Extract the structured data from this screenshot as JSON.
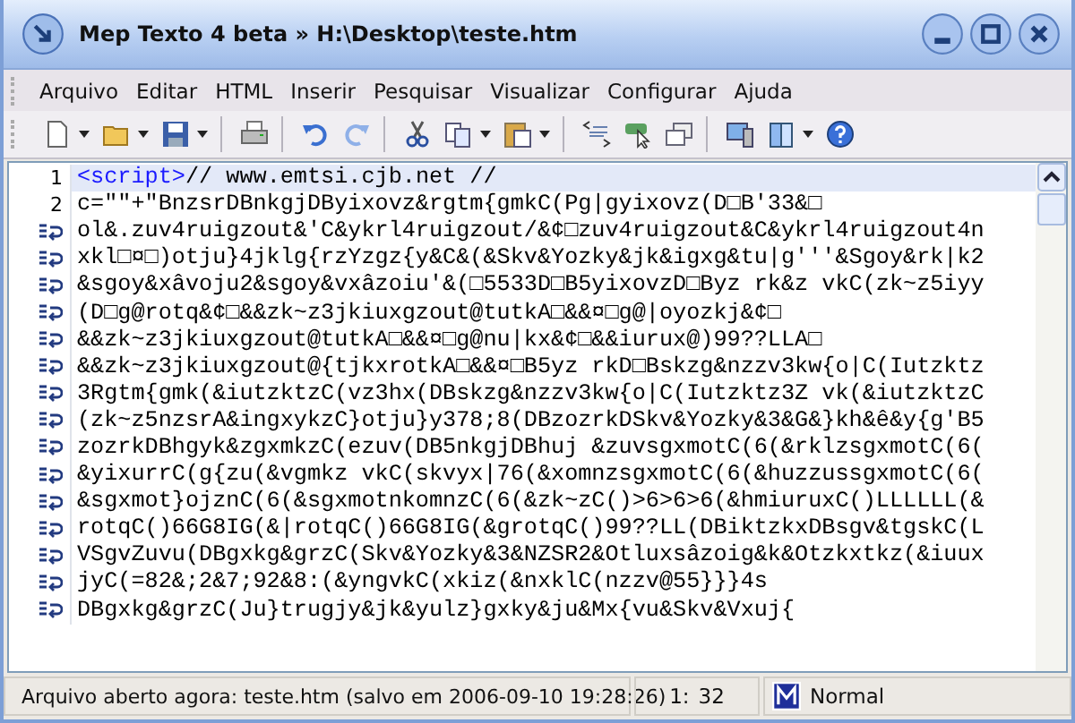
{
  "window": {
    "title": "Mep Texto 4 beta » H:\\Desktop\\teste.htm"
  },
  "menu": [
    "Arquivo",
    "Editar",
    "HTML",
    "Inserir",
    "Pesquisar",
    "Visualizar",
    "Configurar",
    "Ajuda"
  ],
  "editor": {
    "lines": [
      {
        "kind": "numbered",
        "number": "1",
        "selected": true,
        "tag": "<script>",
        "text": "// www.emtsi.cjb.net //"
      },
      {
        "kind": "numbered",
        "number": "2",
        "selected": false,
        "text": "c=\"\"+\"BnzsrDBnkgjDByixovz&rgtm{gmkC(Pg|gyixovz(D□B'33&□"
      },
      {
        "kind": "wrap",
        "selected": false,
        "text": "ol&.zuv4ruigzout&'C&ykrl4ruigzout/&¢□zuv4ruigzout&C&ykrl4ruigzout4n"
      },
      {
        "kind": "wrap",
        "selected": false,
        "text": "xkl□¤□)otju}4jklg{rzYzgz{y&C&(&Skv&Yozky&jk&igxg&tu|g'''&Sgoy&rk|k2"
      },
      {
        "kind": "wrap",
        "selected": false,
        "text": "&sgoy&xâvoju2&sgoy&vxâzoiu'&(□5533D□B5yixovzD□Byz rk&z vkC(zk~z5iyy"
      },
      {
        "kind": "wrap",
        "selected": false,
        "text": "(D□g@rotq&¢□&&zk~z3jkiuxgzout@tutkA□&&¤□g@|oyozkj&¢□"
      },
      {
        "kind": "wrap",
        "selected": false,
        "text": "&&zk~z3jkiuxgzout@tutkA□&&¤□g@nu|kx&¢□&&iurux@)99??LLA□"
      },
      {
        "kind": "wrap",
        "selected": false,
        "text": "&&zk~z3jkiuxgzout@{tjkxrotkA□&&¤□B5yz rkD□Bskzg&nzzv3kw{o|C(Iutzktz"
      },
      {
        "kind": "wrap",
        "selected": false,
        "text": "3Rgtm{gmk(&iutzktzC(vz3hx(DBskzg&nzzv3kw{o|C(Iutzktz3Z vk(&iutzktzC"
      },
      {
        "kind": "wrap",
        "selected": false,
        "text": "(zk~z5nzsrA&ingxykzC}otju}y378;8(DBzozrkDSkv&Yozky&3&G&}kh&ê&y{g'B5"
      },
      {
        "kind": "wrap",
        "selected": false,
        "text": "zozrkDBhgyk&zgxmkzC(ezuv(DB5nkgjDBhuj &zuvsgxmotC(6(&rklzsgxmotC(6("
      },
      {
        "kind": "wrap",
        "selected": false,
        "text": "&yixurrC(g{zu(&vgmkz vkC(skvyx|76(&xomnzsgxmotC(6(&huzzussgxmotC(6("
      },
      {
        "kind": "wrap",
        "selected": false,
        "text": "&sgxmot}ojznC(6(&sgxmotnkomnzC(6(&zk~zC()>6>6>6(&hmiuruxC()LLLLLL(&"
      },
      {
        "kind": "wrap",
        "selected": false,
        "text": "rotqC()66G8IG(&|rotqC()66G8IG(&grotqC()99??LL(DBiktzkxDBsgv&tgskC(L"
      },
      {
        "kind": "wrap",
        "selected": false,
        "text": "VSgvZuvu(DBgxkg&grzC(Skv&Yozky&3&NZSR2&Otluxsâzoig&k&Otzkxtkz(&iuux"
      },
      {
        "kind": "wrap",
        "selected": false,
        "text": "jyC(=82&;2&7;92&8:(&yngvkC(xkiz(&nxklC(nzzv@55}}}4s"
      },
      {
        "kind": "wrap",
        "selected": false,
        "text": "DBgxkg&grzC(Ju}trugjy&jk&yulz}gxky&ju&Mx{vu&Skv&Vxuj{"
      }
    ]
  },
  "status_bar": {
    "message": "Arquivo aberto agora: teste.htm (salvo em 2006-09-10 19:28:26)",
    "line": "1:",
    "column": "32",
    "mode": "Normal"
  }
}
